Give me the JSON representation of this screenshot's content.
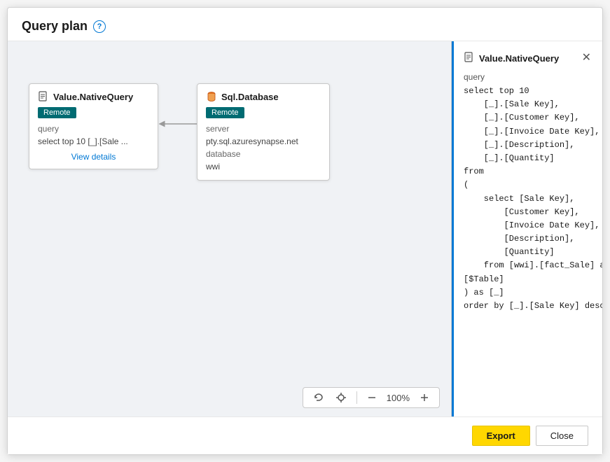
{
  "dialog": {
    "title": "Query plan",
    "help_icon_label": "?"
  },
  "nodes": {
    "native_query": {
      "title": "Value.NativeQuery",
      "badge": "Remote",
      "prop_query_label": "query",
      "prop_query_value": "select top 10 [_].[Sale ...",
      "view_details": "View details"
    },
    "sql_database": {
      "title": "Sql.Database",
      "badge": "Remote",
      "prop_server_label": "server",
      "prop_server_value": "pty.sql.azuresynapse.net",
      "prop_database_label": "database",
      "prop_database_value": "wwi"
    }
  },
  "toolbar": {
    "zoom_level": "100%"
  },
  "detail_panel": {
    "title": "Value.NativeQuery",
    "section_label": "query",
    "code": "select top 10\n    [_].[Sale Key],\n    [_].[Customer Key],\n    [_].[Invoice Date Key],\n    [_].[Description],\n    [_].[Quantity]\nfrom\n(\n    select [Sale Key],\n        [Customer Key],\n        [Invoice Date Key],\n        [Description],\n        [Quantity]\n    from [wwi].[fact_Sale] as\n[$Table]\n) as [_]\norder by [_].[Sale Key] desc"
  },
  "footer": {
    "export_label": "Export",
    "close_label": "Close"
  }
}
